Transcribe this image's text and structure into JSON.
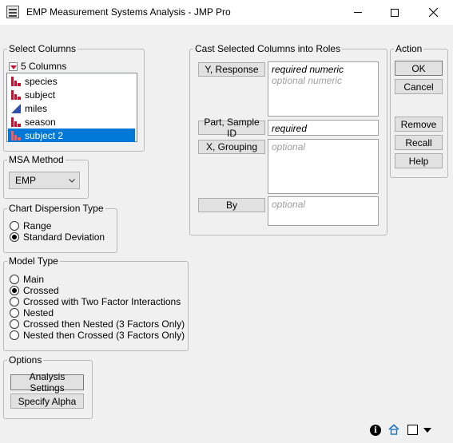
{
  "window": {
    "title": "EMP Measurement Systems Analysis - JMP Pro",
    "minimize_glyph": "—",
    "maximize_glyph": "☐",
    "close_glyph": "✕"
  },
  "select_columns": {
    "legend": "Select Columns",
    "count_label": "5 Columns",
    "columns": [
      {
        "name": "species",
        "icon": "nominal-icon",
        "selected": false
      },
      {
        "name": "subject",
        "icon": "nominal-icon",
        "selected": false
      },
      {
        "name": "miles",
        "icon": "continuous-icon",
        "selected": false
      },
      {
        "name": "season",
        "icon": "nominal-icon",
        "selected": false
      },
      {
        "name": "subject 2",
        "icon": "nominal-icon",
        "selected": true
      }
    ]
  },
  "msa_method": {
    "legend": "MSA Method",
    "selected": "EMP"
  },
  "chart_dispersion": {
    "legend": "Chart Dispersion Type",
    "options": [
      {
        "label": "Range",
        "checked": false
      },
      {
        "label": "Standard Deviation",
        "checked": true
      }
    ]
  },
  "model_type": {
    "legend": "Model Type",
    "options": [
      {
        "label": "Main",
        "checked": false
      },
      {
        "label": "Crossed",
        "checked": true
      },
      {
        "label": "Crossed with Two Factor Interactions",
        "checked": false
      },
      {
        "label": "Nested",
        "checked": false
      },
      {
        "label": "Crossed then Nested (3 Factors Only)",
        "checked": false
      },
      {
        "label": "Nested then Crossed (3 Factors Only)",
        "checked": false
      }
    ]
  },
  "options": {
    "legend": "Options",
    "analysis_settings": "Analysis Settings",
    "specify_alpha": "Specify Alpha"
  },
  "cast_roles": {
    "legend": "Cast Selected Columns into Roles",
    "y_response": {
      "button": "Y, Response",
      "required": "required numeric",
      "optional": "optional numeric"
    },
    "part_sample": {
      "button": "Part, Sample ID",
      "required": "required"
    },
    "x_grouping": {
      "button": "X, Grouping",
      "optional": "optional"
    },
    "by": {
      "button": "By",
      "optional": "optional"
    }
  },
  "action": {
    "legend": "Action",
    "ok": "OK",
    "cancel": "Cancel",
    "remove": "Remove",
    "recall": "Recall",
    "help": "Help"
  },
  "statusbar": {
    "info_icon": "info-icon",
    "home_icon": "home-icon",
    "window_icon": "window-icon"
  }
}
